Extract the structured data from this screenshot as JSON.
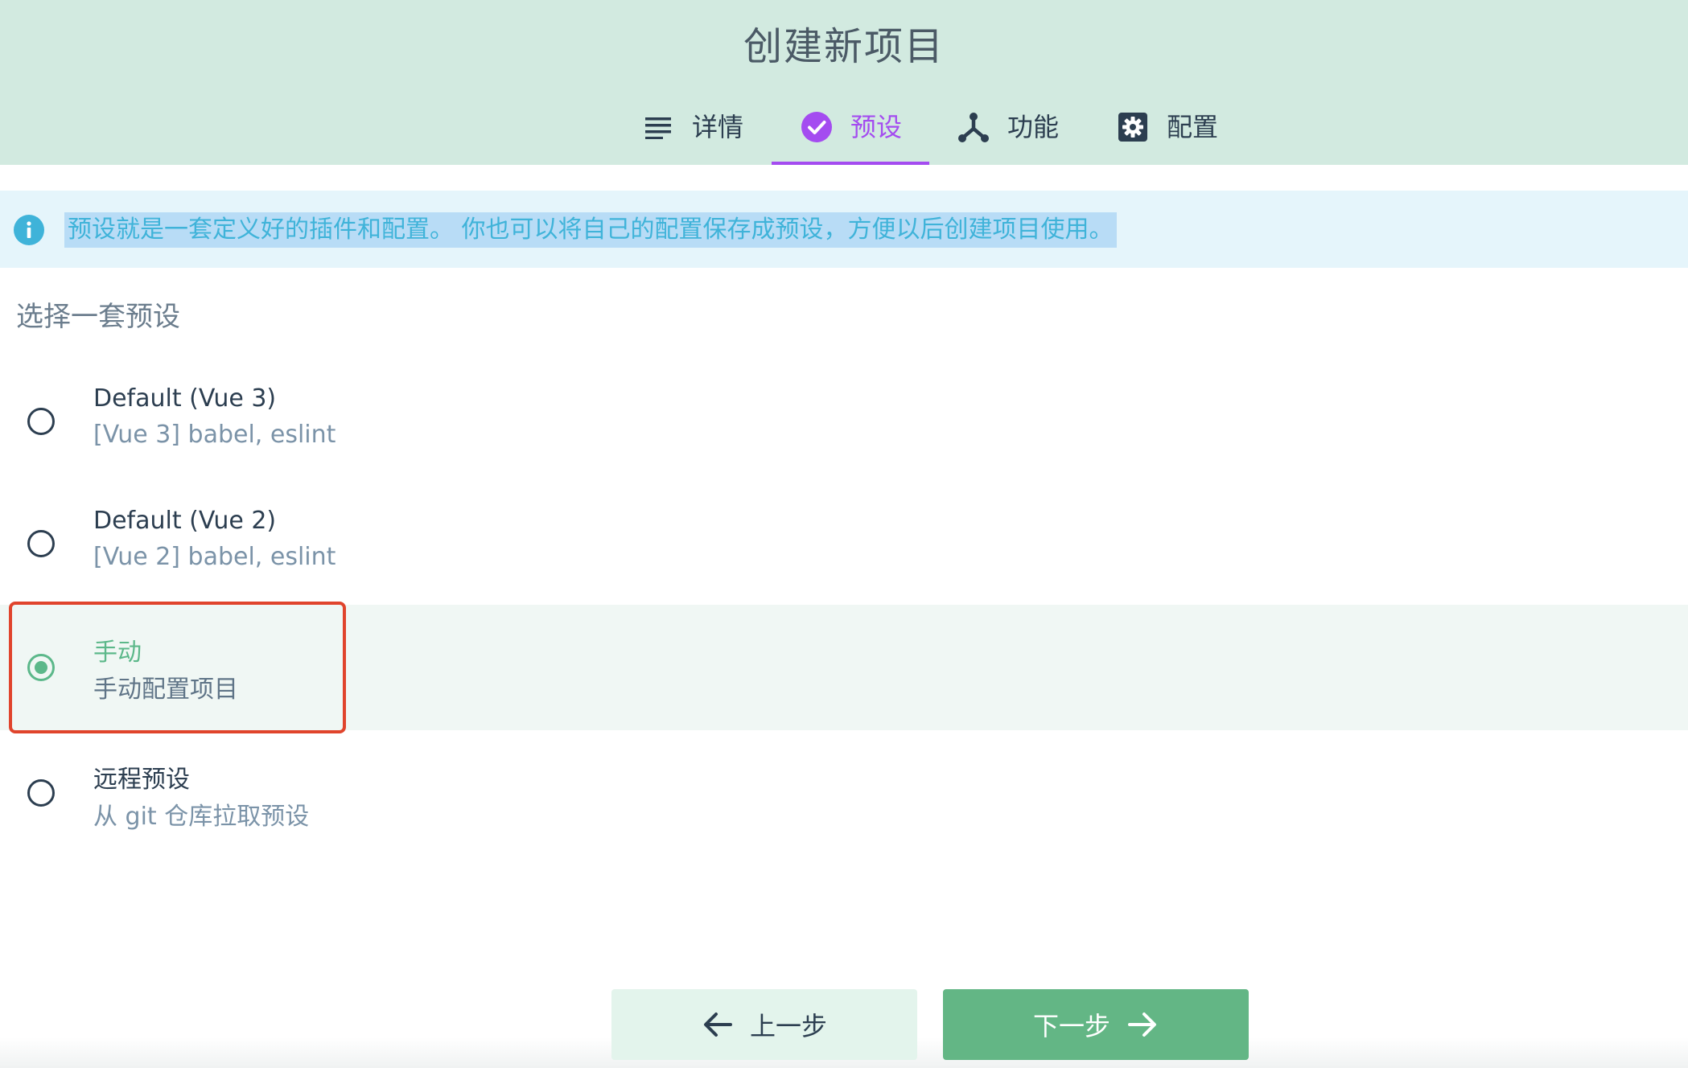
{
  "header": {
    "title": "创建新项目",
    "tabs": [
      {
        "label": "详情",
        "icon": "list-icon"
      },
      {
        "label": "预设",
        "icon": "check-circle-icon",
        "active": true
      },
      {
        "label": "功能",
        "icon": "fork-icon"
      },
      {
        "label": "配置",
        "icon": "gear-icon"
      }
    ]
  },
  "info": {
    "icon": "info-icon",
    "text": "预设就是一套定义好的插件和配置。 你也可以将自己的配置保存成预设，方便以后创建项目使用。"
  },
  "section_title": "选择一套预设",
  "presets": [
    {
      "name": "Default (Vue 3)",
      "description": "[Vue 3] babel, eslint",
      "selected": false
    },
    {
      "name": "Default (Vue 2)",
      "description": "[Vue 2] babel, eslint",
      "selected": false
    },
    {
      "name": "手动",
      "description": "手动配置项目",
      "selected": true
    },
    {
      "name": "远程预设",
      "description": "从 git 仓库拉取预设",
      "selected": false
    }
  ],
  "buttons": {
    "prev_label": "上一步",
    "next_label": "下一步"
  },
  "colors": {
    "header_bg": "#d2eae0",
    "active_tab": "#a44cf0",
    "accent_green": "#5cb88a",
    "info_blue": "#3fb3d9",
    "highlight_red": "#e0442c"
  }
}
